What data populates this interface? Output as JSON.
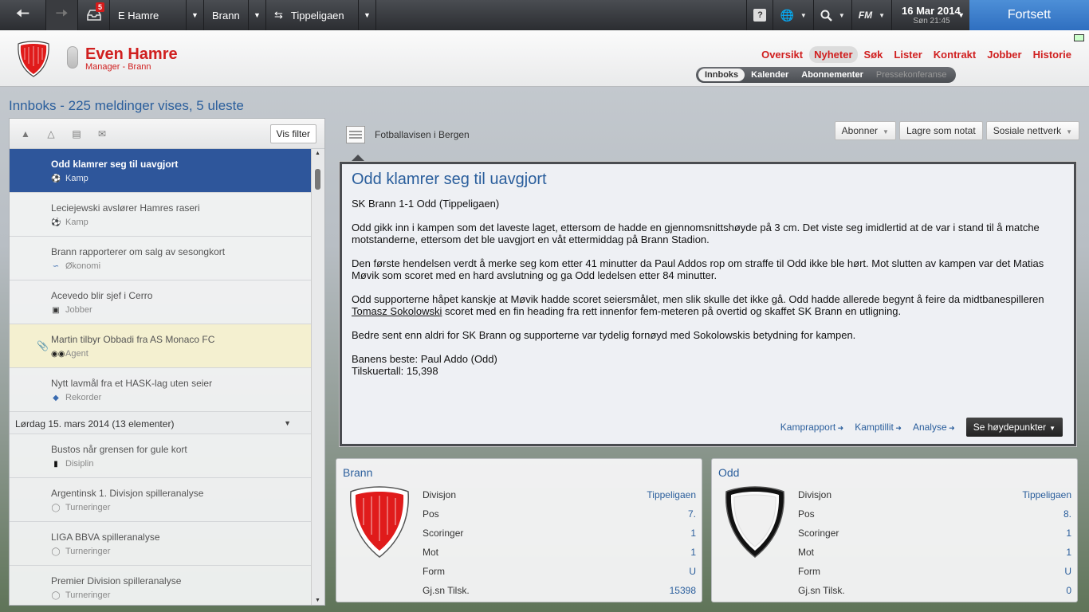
{
  "topbar": {
    "inbox_badge": "5",
    "manager_select": "E Hamre",
    "club_select": "Brann",
    "league_select": "Tippeligaen",
    "help_label": "?",
    "fm_label": "FM",
    "date": "16 Mar 2014",
    "time": "Søn 21:45",
    "continue_label": "Fortsett"
  },
  "header": {
    "manager_name": "Even Hamre",
    "manager_role": "Manager - Brann",
    "nav": [
      "Oversikt",
      "Nyheter",
      "Søk",
      "Lister",
      "Kontrakt",
      "Jobber",
      "Historie"
    ],
    "subnav": [
      "Innboks",
      "Kalender",
      "Abonnementer",
      "Pressekonferanse"
    ]
  },
  "page_title": "Innboks - 225 meldinger vises, 5 uleste",
  "inbox": {
    "filter_button": "Vis filter",
    "messages": [
      {
        "subject": "Odd klamrer seg til uavgjort",
        "category": "Kamp"
      },
      {
        "subject": "Leciejewski avslører Hamres raseri",
        "category": "Kamp"
      },
      {
        "subject": "Brann rapporterer om salg av sesongkort",
        "category": "Økonomi"
      },
      {
        "subject": "Acevedo blir sjef i Cerro",
        "category": "Jobber"
      },
      {
        "subject": "Martin tilbyr Obbadi fra AS Monaco FC",
        "category": "Agent"
      },
      {
        "subject": "Nytt lavmål fra et HASK-lag uten seier",
        "category": "Rekorder"
      }
    ],
    "group_header": "Lørdag 15. mars 2014 (13 elementer)",
    "group_messages": [
      {
        "subject": "Bustos når grensen for gule kort",
        "category": "Disiplin"
      },
      {
        "subject": "Argentinsk 1. Divisjon spilleranalyse",
        "category": "Turneringer"
      },
      {
        "subject": "LIGA BBVA spilleranalyse",
        "category": "Turneringer"
      },
      {
        "subject": "Premier Division spilleranalyse",
        "category": "Turneringer"
      }
    ]
  },
  "article": {
    "source": "Fotballavisen i Bergen",
    "buttons": [
      "Abonner",
      "Lagre som notat",
      "Sosiale nettverk"
    ],
    "title": "Odd klamrer seg til uavgjort",
    "result_line": "SK Brann 1-1 Odd (Tippeligaen)",
    "p1": "Odd gikk inn i kampen som det laveste laget, ettersom de hadde en gjennomsnittshøyde på 3 cm. Det viste seg imidlertid at de var i stand til å matche motstanderne, ettersom det ble uavgjort en våt ettermiddag på Brann Stadion.",
    "p2": "Den første hendelsen verdt å merke seg kom etter 41 minutter da Paul Addos rop om straffe til Odd ikke ble hørt. Mot slutten av kampen var det Matias Møvik som scoret med en hard avslutning og ga Odd ledelsen etter 84 minutter.",
    "p3_before": "Odd supporterne håpet kanskje at Møvik hadde scoret seiersmålet, men slik skulle det ikke gå. Odd hadde allerede begynt å feire da midtbanespilleren ",
    "p3_link": "Tomasz Sokolowski",
    "p3_after": " scoret med en fin heading fra rett innenfor fem-meteren på overtid og skaffet SK Brann en utligning.",
    "p4": "Bedre sent enn aldri for SK Brann og supporterne var tydelig fornøyd med Sokolowskis betydning for kampen.",
    "best_player": "Banens beste: Paul Addo (Odd)",
    "attendance": "Tilskuertall: 15,398",
    "links": [
      "Kamprapport",
      "Kamptillit",
      "Analyse"
    ],
    "highlights_button": "Se høydepunkter"
  },
  "teams": {
    "labels": [
      "Divisjon",
      "Pos",
      "Scoringer",
      "Mot",
      "Form",
      "Gj.sn Tilsk."
    ],
    "home": {
      "name": "Brann",
      "values": [
        "Tippeligaen",
        "7.",
        "1",
        "1",
        "U",
        "15398"
      ],
      "color": "#e01b1b"
    },
    "away": {
      "name": "Odd",
      "values": [
        "Tippeligaen",
        "8.",
        "1",
        "1",
        "U",
        "0"
      ],
      "color": "#ffffff"
    }
  },
  "colors": {
    "accent_red": "#d01f1f",
    "link_blue": "#2a5e9c",
    "selected_row": "#2e569b",
    "continue_blue": "#3a7cc8"
  }
}
